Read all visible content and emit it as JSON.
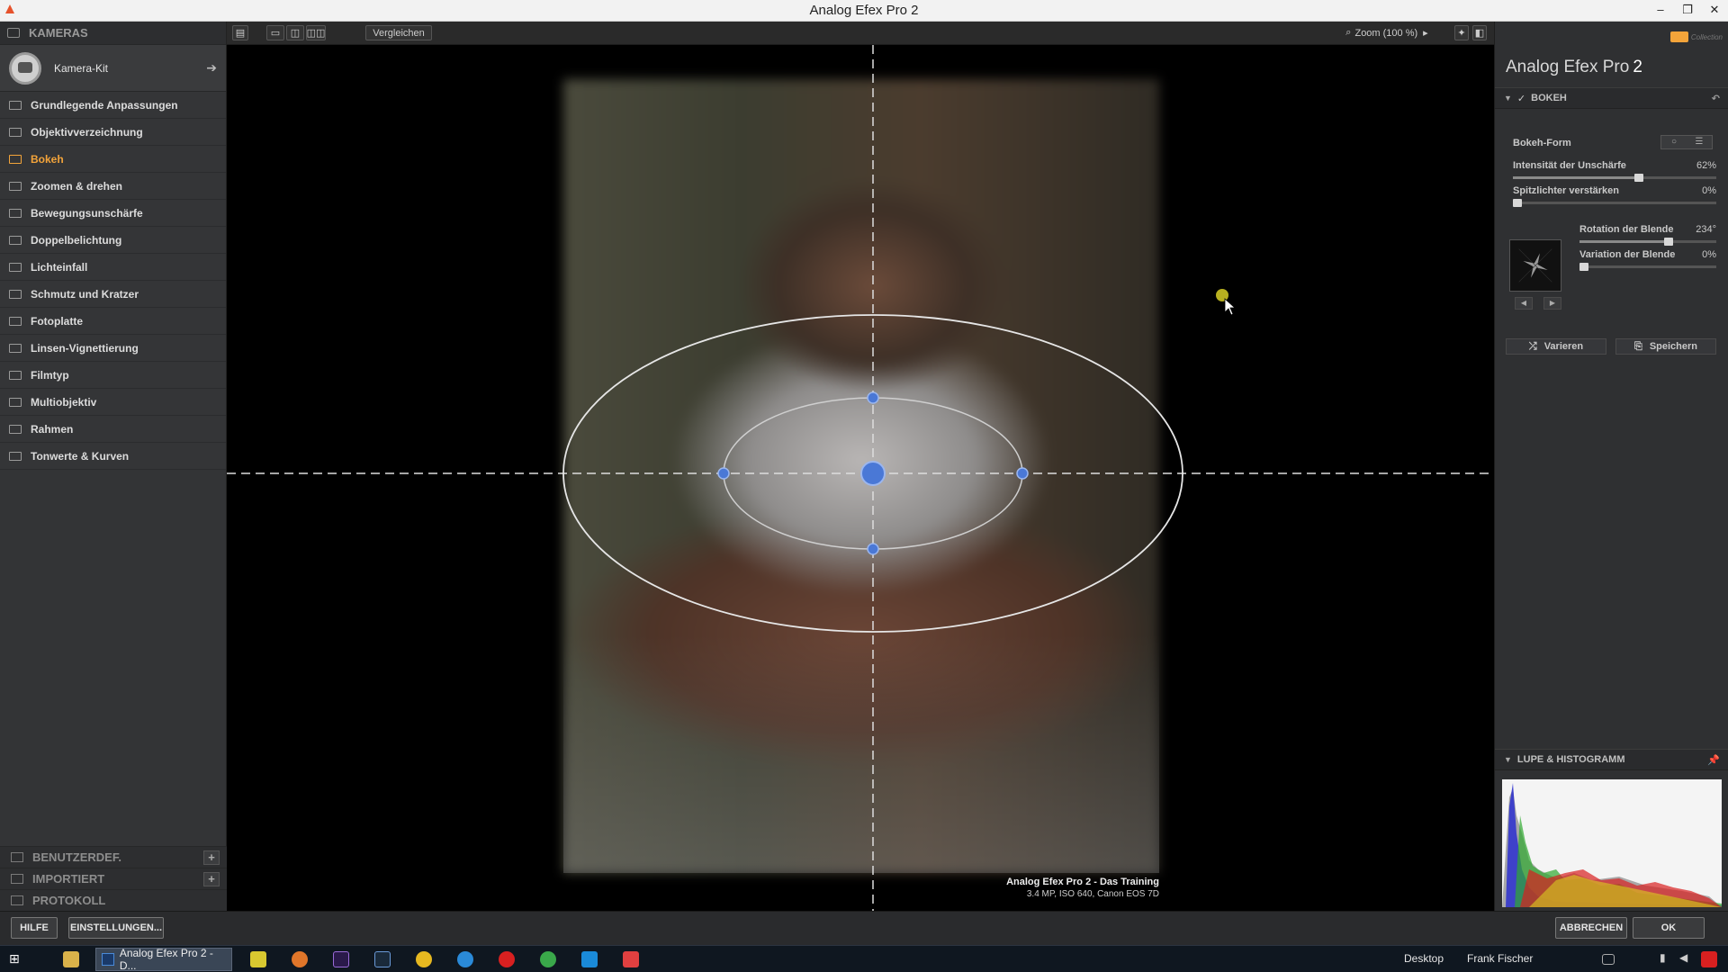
{
  "window": {
    "title": "Analog Efex Pro 2",
    "controls": [
      "–",
      "❐",
      "✕"
    ]
  },
  "left_panel": {
    "section_title": "KAMERAS",
    "kit_label": "Kamera-Kit",
    "items": [
      {
        "label": "Grundlegende Anpassungen",
        "active": false
      },
      {
        "label": "Objektivverzeichnung",
        "active": false
      },
      {
        "label": "Bokeh",
        "active": true
      },
      {
        "label": "Zoomen & drehen",
        "active": false
      },
      {
        "label": "Bewegungsunschärfe",
        "active": false
      },
      {
        "label": "Doppelbelichtung",
        "active": false
      },
      {
        "label": "Lichteinfall",
        "active": false
      },
      {
        "label": "Schmutz und Kratzer",
        "active": false
      },
      {
        "label": "Fotoplatte",
        "active": false
      },
      {
        "label": "Linsen-Vignettierung",
        "active": false
      },
      {
        "label": "Filmtyp",
        "active": false
      },
      {
        "label": "Multiobjektiv",
        "active": false
      },
      {
        "label": "Rahmen",
        "active": false
      },
      {
        "label": "Tonwerte & Kurven",
        "active": false
      }
    ],
    "bottom_sections": [
      {
        "label": "BENUTZERDEF.",
        "plus": "+"
      },
      {
        "label": "IMPORTIERT",
        "plus": "+"
      },
      {
        "label": "PROTOKOLL",
        "plus": ""
      }
    ]
  },
  "toolbar": {
    "compare_label": "Vergleichen",
    "zoom_label": "Zoom (100 %)"
  },
  "canvas": {
    "caption_title": "Analog Efex Pro 2 - Das Training",
    "caption_meta": "3.4 MP, ISO 640, Canon EOS 7D"
  },
  "right_panel": {
    "brand_name": "Analog Efex Pro",
    "brand_version": "2",
    "nik_text": "Collection",
    "section_bokeh": "BOKEH",
    "bokeh_form_label": "Bokeh-Form",
    "controls": [
      {
        "label": "Intensität der Unschärfe",
        "value": "62%",
        "level": 0.62
      },
      {
        "label": "Spitzlichter verstärken",
        "value": "0%",
        "level": 0.0
      },
      {
        "label": "Rotation der Blende",
        "value": "234°",
        "level": 0.65
      },
      {
        "label": "Variation der Blende",
        "value": "0%",
        "level": 0.0
      }
    ],
    "vary_label": "Varieren",
    "save_label": "Speichern",
    "section_histogram": "LUPE & HISTOGRAMM"
  },
  "bottom_bar": {
    "help_label": "HILFE",
    "settings_label": "EINSTELLUNGEN...",
    "cancel_label": "ABBRECHEN",
    "ok_label": "OK"
  },
  "taskbar": {
    "active_app_label": "Analog Efex Pro 2 - D...",
    "desktop_label": "Desktop",
    "user_label": "Frank Fischer"
  },
  "colors": {
    "accent": "#f3a43a",
    "control_point": "#4a78d6",
    "panel_bg": "#333436"
  }
}
